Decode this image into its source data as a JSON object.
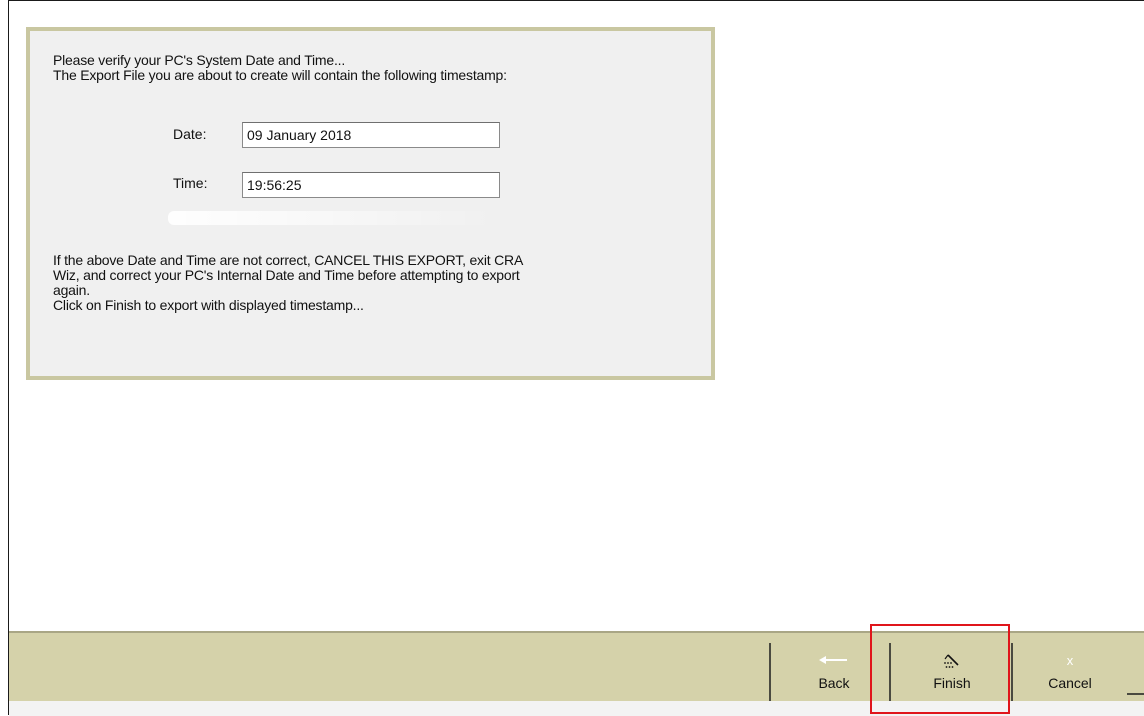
{
  "panel": {
    "line1": "Please verify your PC's System Date and Time...",
    "line2": "The Export File you are about to create will contain the following timestamp:",
    "date_label": "Date:",
    "date_value": "09 January 2018",
    "time_label": "Time:",
    "time_value": "19:56:25",
    "warning_line1": "If the above Date and Time are not correct, CANCEL THIS EXPORT, exit CRA",
    "warning_line2": "Wiz, and correct your PC's Internal Date and Time before attempting to export",
    "warning_line3": "again.",
    "finish_hint": "Click on Finish to export with displayed timestamp..."
  },
  "footer": {
    "back_label": "Back",
    "finish_label": "Finish",
    "cancel_label": "Cancel",
    "back_icon": "arrow-left-icon",
    "finish_icon": "wizard-wand-icon",
    "cancel_icon": "close-icon"
  },
  "colors": {
    "panel_border": "#c9c7a1",
    "panel_bg": "#f0f0f0",
    "footer_bg": "#d5d2aa",
    "highlight": "#e0151b"
  }
}
